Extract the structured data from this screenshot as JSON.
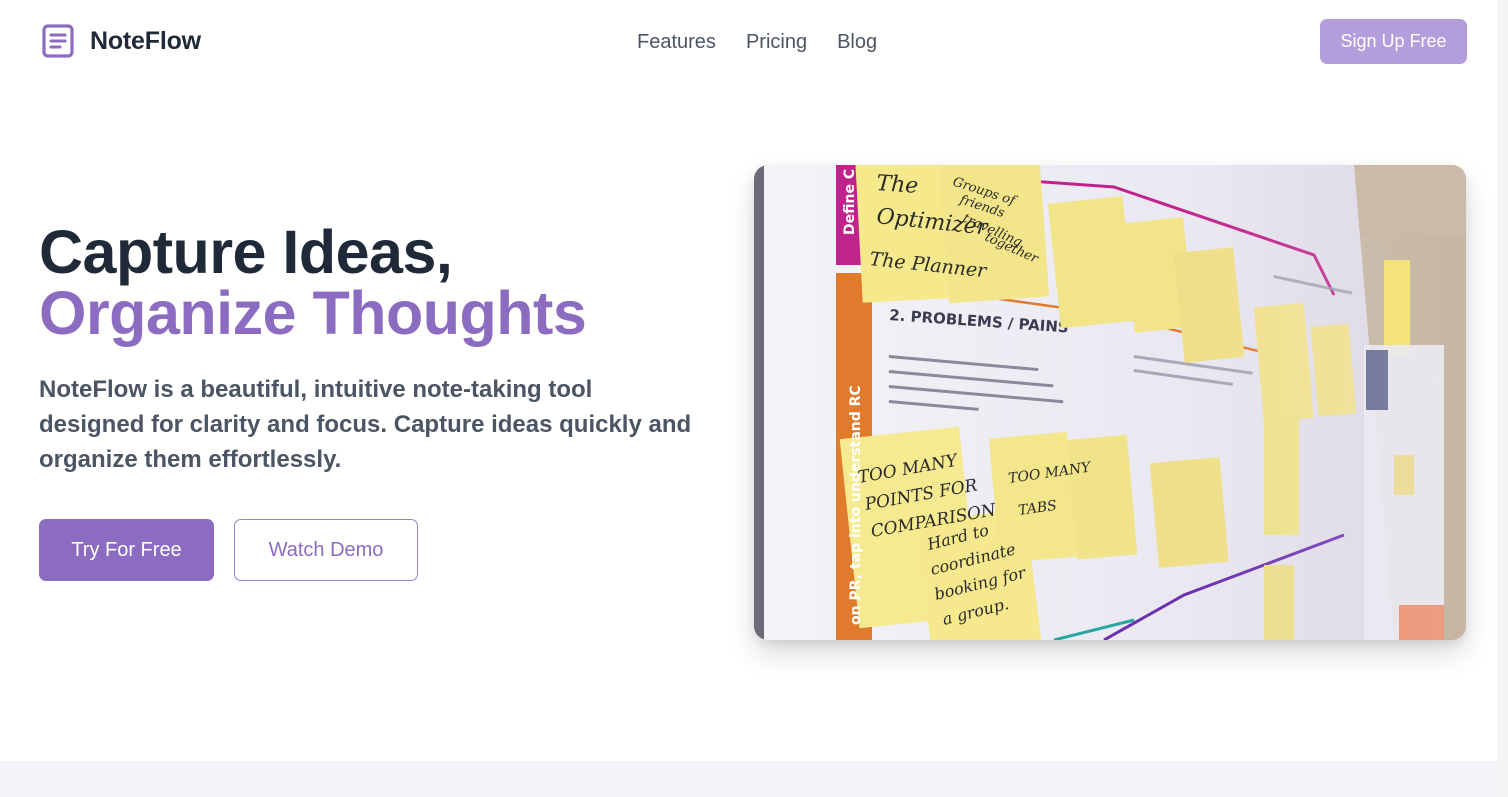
{
  "brand": {
    "name": "NoteFlow",
    "icon": "document-lines-icon",
    "accent_color": "#8b6cc1"
  },
  "nav": {
    "items": [
      "Features",
      "Pricing",
      "Blog"
    ]
  },
  "header": {
    "signup_label": "Sign Up Free"
  },
  "hero": {
    "title_line1": "Capture Ideas,",
    "title_line2": "Organize Thoughts",
    "description": "NoteFlow is a beautiful, intuitive note-taking tool designed for clarity and focus. Capture ideas quickly and organize them effortlessly.",
    "primary_cta": "Try For Free",
    "secondary_cta": "Watch Demo"
  },
  "hero_image": {
    "alt": "Whiteboard covered with yellow sticky notes"
  },
  "colors": {
    "primary": "#8b6cc1",
    "primary_light": "#b39ddb",
    "text_dark": "#1f2937",
    "text_muted": "#4b5563"
  }
}
